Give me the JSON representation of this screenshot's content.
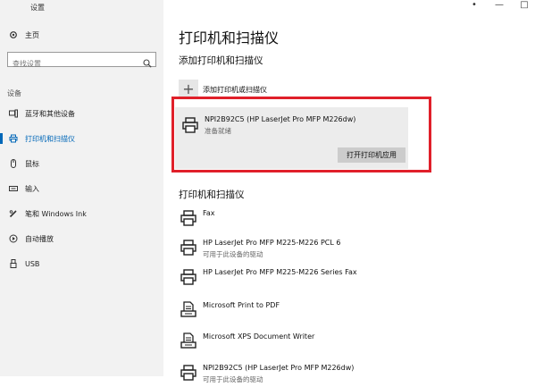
{
  "window": {
    "title": "设置",
    "controls": [
      "•",
      "—",
      "□"
    ]
  },
  "sidebar": {
    "home": "主页",
    "search_placeholder": "查找设置",
    "section": "设备",
    "items": [
      {
        "label": "蓝牙和其他设备",
        "icon": "bluetooth-devices-icon"
      },
      {
        "label": "打印机和扫描仪",
        "icon": "printer-icon",
        "active": true
      },
      {
        "label": "鼠标",
        "icon": "mouse-icon"
      },
      {
        "label": "输入",
        "icon": "keyboard-icon"
      },
      {
        "label": "笔和 Windows Ink",
        "icon": "pen-icon"
      },
      {
        "label": "自动播放",
        "icon": "autoplay-icon"
      },
      {
        "label": "USB",
        "icon": "usb-icon"
      }
    ]
  },
  "main": {
    "title": "打印机和扫描仪",
    "add_section_title": "添加打印机和扫描仪",
    "add_label": "添加打印机或扫描仪",
    "selected_printer": {
      "name": "NPI2B92C5 (HP LaserJet Pro MFP M226dw)",
      "status": "准备就绪",
      "button": "打开打印机应用"
    },
    "list_title": "打印机和扫描仪",
    "printers": [
      {
        "name": "Fax",
        "status": "",
        "icon": "printer-icon"
      },
      {
        "name": "HP LaserJet Pro MFP M225-M226 PCL 6",
        "status": "可用于此设备的驱动",
        "icon": "printer-icon"
      },
      {
        "name": "HP LaserJet Pro MFP M225-M226 Series Fax",
        "status": "",
        "icon": "printer-icon"
      },
      {
        "name": "Microsoft Print to PDF",
        "status": "",
        "icon": "document-printer-icon"
      },
      {
        "name": "Microsoft XPS Document Writer",
        "status": "",
        "icon": "document-printer-icon"
      },
      {
        "name": "NPI2B92C5 (HP LaserJet Pro MFP M226dw)",
        "status": "可用于此设备的驱动",
        "icon": "printer-icon"
      }
    ]
  },
  "colors": {
    "accent": "#0067b8",
    "highlight_outline": "#e0202a",
    "sidebar_bg": "#f2f2f2"
  }
}
